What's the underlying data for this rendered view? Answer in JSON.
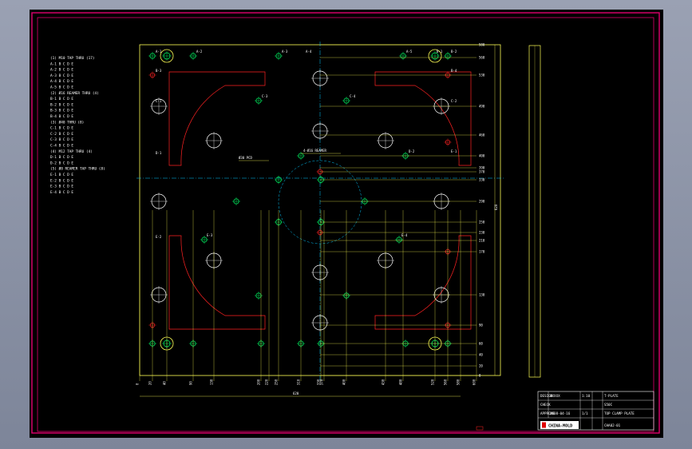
{
  "drawing": {
    "frame_color": "#e0006e",
    "plate_color": "#ffff55",
    "hole_color": "#00ff66",
    "pocket_color": "#ff2222",
    "centerline_color": "#00c8ff"
  },
  "notes": [
    "(1) M10  TAP  THRU (17)",
    "  A-1  B  C  D  E",
    "  A-2  B  C  D  E",
    "  A-3  B  C  D  E",
    "  A-4  B  C  D  E",
    "  A-5  B  C  D  E",
    "(2) Ø16 REAMER THRU (4)",
    "  B-1  B  C  D  E",
    "  B-2  B  C  D  E",
    "  B-3  B  C  D  E",
    "  B-4  B  C  D  E",
    "(3) Ø40  THRU (8)",
    "  C-1  B  C  D  E",
    "  C-2  B  C  D  E",
    "  C-3  B  C  D  E",
    "  C-4  B  C  D  E",
    "(4) M12  TAP  THRU (4)",
    "  D-1  B  C  D  E",
    "  D-2  B  C  D  E",
    "(5) Ø8  REAMER TAP THRU (8)",
    "  E-1  B  C  D  E",
    "  E-2  B  C  D  E",
    "  E-3  B  C  D  E",
    "  E-4  B  C  D  E"
  ],
  "dimensions": {
    "overall_width": "620",
    "overall_height": "620",
    "right_dims": [
      "580",
      "560",
      "530",
      "490",
      "460",
      "400",
      "390",
      "370",
      "330",
      "290",
      "250",
      "230",
      "210",
      "170",
      "130",
      "90",
      "60",
      "40",
      "20",
      "0"
    ],
    "bottom_dims": [
      "0",
      "20",
      "40",
      "90",
      "130",
      "200",
      "220",
      "250",
      "310",
      "330",
      "370",
      "400",
      "430",
      "480",
      "520",
      "560",
      "580",
      "600"
    ]
  },
  "hole_labels": [
    "A-1",
    "A-2",
    "A-3",
    "A-4",
    "A-5",
    "B-1",
    "B-2",
    "B-3",
    "B-4",
    "C-1",
    "C-2",
    "C-3",
    "C-4",
    "D-1",
    "D-2",
    "E-1",
    "E-2",
    "E-3",
    "E-4"
  ],
  "callout": "4-Ø16 REAMER",
  "callout2": "Ø30 PCD",
  "title_block": {
    "company": "XXXXX",
    "part": "T-PLATE",
    "material": "S50C",
    "title": "TOP CLAMP PLATE",
    "drawing_no": "CHA02-01",
    "scale": "1:10",
    "sheet": "1/1",
    "designer": "DESIGN",
    "checker": "CHECK",
    "approver": "APPROVE",
    "date": "2008-04-16",
    "logo_text": "CHINA-MOLD"
  }
}
